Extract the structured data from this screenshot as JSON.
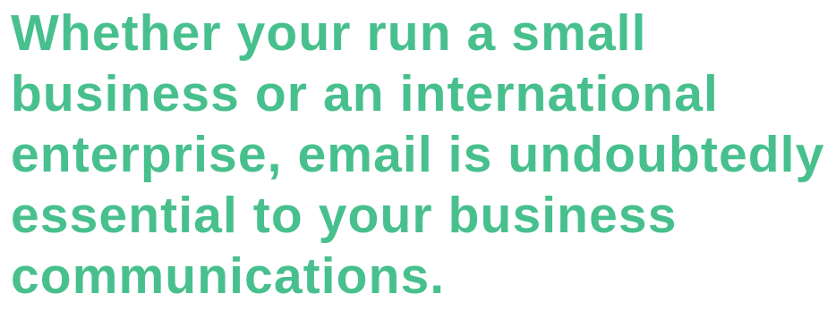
{
  "quote": {
    "color": "#48c08e",
    "lines": [
      "Whether your run a small",
      "business or an international",
      "enterprise, email is undoubtedly",
      "essential to your business",
      "communications."
    ]
  }
}
